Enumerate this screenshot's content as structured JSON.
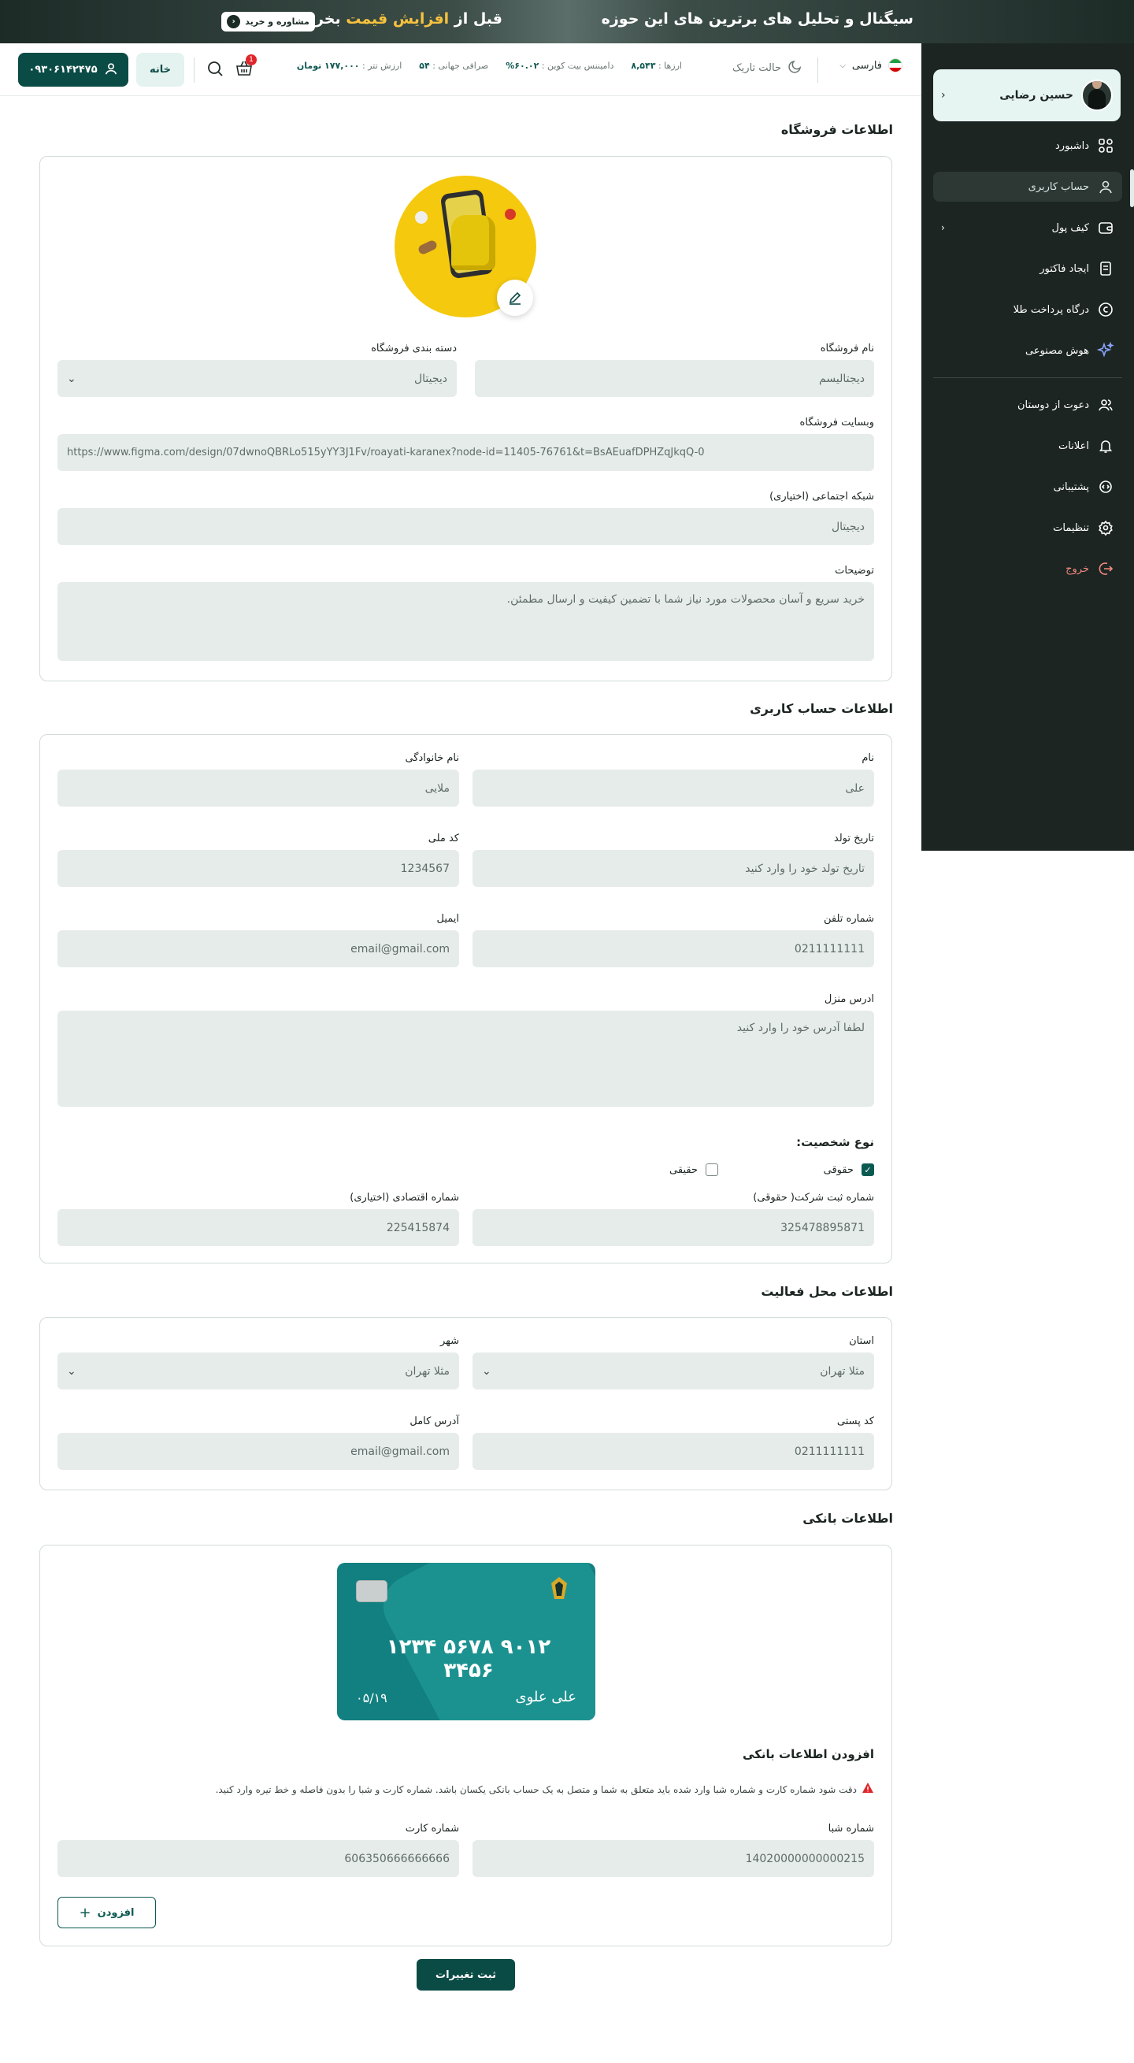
{
  "banner": {
    "headline": "سیگنال و تحلیل های برترین های این حوزه",
    "offer_before": "قبل از ",
    "offer_highlight": "افزایش قیمت",
    "offer_after": " بخرید",
    "cta": "مشاوره و خرید"
  },
  "sidebar": {
    "user_name": "حسین رضایی",
    "items": [
      {
        "label": "داشبورد",
        "icon": "dashboard-icon"
      },
      {
        "label": "حساب کاربری",
        "icon": "user-icon",
        "active": true
      },
      {
        "label": "کیف پول",
        "icon": "wallet-icon"
      },
      {
        "label": "ایجاد فاکتور",
        "icon": "invoice-icon"
      },
      {
        "label": "درگاه پرداخت طلا",
        "icon": "gold-coin-icon"
      },
      {
        "label": "هوش مصنوعی",
        "icon": "ai-sparkle-icon"
      },
      {
        "label": "دعوت از دوستان",
        "icon": "invite-users-icon"
      },
      {
        "label": "اعلانات",
        "icon": "bell-icon"
      },
      {
        "label": "پشتیبانی",
        "icon": "support-icon"
      },
      {
        "label": "تنظیمات",
        "icon": "gear-icon"
      },
      {
        "label": "خروج",
        "icon": "logout-icon"
      }
    ]
  },
  "topbar": {
    "language": "فارسی",
    "dark_mode": "حالت تاریک",
    "stats": {
      "currencies_label": "ارزها :",
      "currencies_value": "۸,۵۴۳",
      "dominance_label": "دامیننس بیت کوین :",
      "dominance_value": "۶۰.۰۲%",
      "exchanges_label": "صرافی جهانی :",
      "exchanges_value": "۵۴",
      "tether_label": "ارزش تتر :",
      "tether_value": "۱۷۷,۰۰۰ تومان"
    },
    "cart_count": "1",
    "home": "خانه",
    "phone": "۰۹۳۰۶۱۴۲۴۷۵"
  },
  "store": {
    "title": "اطلاعات فروشگاه",
    "name_label": "نام فروشگاه",
    "name_value": "دیجتالیسم",
    "category_label": "دسته بندی فروشگاه",
    "category_value": "دیجیتال",
    "website_label": "وبسایت فروشگاه",
    "website_value": "https://www.figma.com/design/07dwnoQBRLo515yYY3J1Fv/roayati-karanex?node-id=11405-76761&t=BsAEuafDPHZqJkqQ-0",
    "social_label": "شبکه اجتماعی (اختیاری)",
    "social_value": "دیجیتال",
    "desc_label": "توضیحات",
    "desc_value": "خرید سریع و آسان محصولات مورد نیاز شما با تضمین کیفیت و ارسال مطمئن."
  },
  "account": {
    "title": "اطلاعات حساب کاربری",
    "first_name_label": "نام",
    "first_name_value": "علی",
    "last_name_label": "نام خانوادگی",
    "last_name_value": "ملایی",
    "birth_label": "تاریخ تولد",
    "birth_placeholder": "تاریخ تولد خود را وارد کنید",
    "national_id_label": "کد ملی",
    "national_id_value": "1234567",
    "phone_label": "شماره تلفن",
    "phone_value": "0211111111",
    "email_label": "ایمیل",
    "email_value": "email@gmail.com",
    "address_label": "ادرس منزل",
    "address_placeholder": "لطفا آدرس خود را وارد کنید",
    "type_title": "نوع شخصیت:",
    "type_legal": "حقوقی",
    "type_real": "حقیقی",
    "reg_label": "شماره ثبت شرکت( حقوقی)",
    "reg_value": "325478895871",
    "eco_label": "شماره اقتصادی (اختیاری)",
    "eco_value": "225415874"
  },
  "location": {
    "title": "اطلاعات محل فعالیت",
    "province_label": "استان",
    "province_value": "مثلا تهران",
    "city_label": "شهر",
    "city_value": "مثلا تهران",
    "postal_label": "کد پستی",
    "postal_value": "0211111111",
    "address_label": "آدرس کامل",
    "address_value": "email@gmail.com"
  },
  "bank": {
    "title": "اطلاعات بانکی",
    "card_number": "۱۲۳۴ ۵۶۷۸ ۹۰۱۲ ۳۴۵۶",
    "card_holder": "علی علوی",
    "card_expiry": "۰۵/۱۹",
    "add_title": "افزودن اطلاعات بانکی",
    "warning": "دقت شود شماره کارت و شماره شبا وارد شده باید متعلق به شما و متصل به یک حساب بانکی یکسان باشد. شماره کارت و شبا را بدون فاصله و خط تیره وارد کنید.",
    "sheba_label": "شماره شبا",
    "sheba_value": "14020000000000215",
    "card_label": "شماره کارت",
    "card_value": "606350666666666",
    "add_button": "افزودن"
  },
  "submit": "ثبت تغییرات",
  "colors": {
    "primary": "#0b4b45",
    "sidebar": "#1c2522",
    "accent": "#f6c23e",
    "danger": "#e0262b"
  }
}
